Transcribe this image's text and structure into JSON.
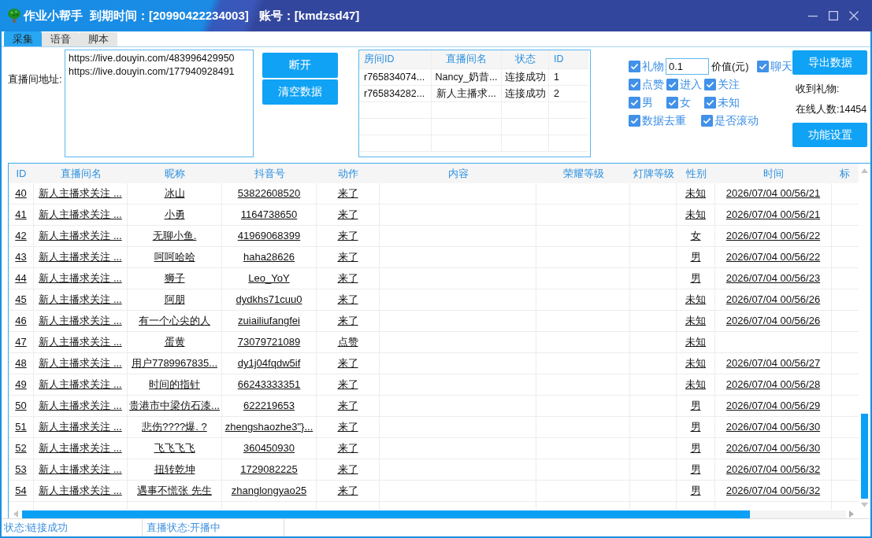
{
  "window": {
    "app_name": "作业小帮手",
    "expiry": "到期时间：[20990422234003]",
    "account": "账号：[kmdzsd47]"
  },
  "tabs": [
    {
      "label": "采集",
      "selected": true
    },
    {
      "label": "语音",
      "selected": false
    },
    {
      "label": "脚本",
      "selected": false
    }
  ],
  "address": {
    "label": "直播间地址:",
    "lines": [
      "https://live.douyin.com/483996429950",
      "https://live.douyin.com/177940928491"
    ]
  },
  "actions": [
    "断开",
    "清空数据"
  ],
  "rooms": {
    "columns": [
      "房间ID",
      "直播间名",
      "状态",
      "ID"
    ],
    "rows": [
      [
        "r765834074...",
        "Nancy_奶昔...",
        "连接成功",
        "1"
      ],
      [
        "r765834282...",
        "新人主播求...",
        "连接成功",
        "2"
      ]
    ]
  },
  "filters": [
    {
      "items": [
        {
          "kind": "checkbox",
          "label": "礼物",
          "checked": true
        },
        {
          "kind": "input",
          "value": "0.1"
        },
        {
          "kind": "text",
          "label": "价值(元)"
        },
        {
          "kind": "checkbox",
          "label": "聊天",
          "checked": true
        }
      ]
    },
    {
      "items": [
        {
          "kind": "checkbox",
          "label": "点赞",
          "checked": true
        },
        {
          "kind": "checkbox",
          "label": "进入",
          "checked": true
        },
        {
          "kind": "checkbox",
          "label": "关注",
          "checked": true
        }
      ]
    },
    {
      "items": [
        {
          "kind": "checkbox",
          "label": "男",
          "checked": true
        },
        {
          "kind": "checkbox",
          "label": "女",
          "checked": true
        },
        {
          "kind": "checkbox",
          "label": "未知",
          "checked": true
        }
      ]
    },
    {
      "items": [
        {
          "kind": "checkbox",
          "label": "数据去重",
          "checked": true
        },
        {
          "kind": "checkbox",
          "label": "是否滚动",
          "checked": true
        }
      ]
    }
  ],
  "side": {
    "export_button": "导出数据",
    "gifts_label": "收到礼物:",
    "online": "在线人数:14454",
    "settings_button": "功能设置"
  },
  "table": {
    "columns": [
      "ID",
      "直播间名",
      "昵称",
      "抖音号",
      "动作",
      "内容",
      "荣耀等级",
      "灯牌等级",
      "性别",
      "时间",
      "标"
    ],
    "rows": [
      {
        "id": "40",
        "live_room": "新人主播求关注 ...",
        "nickname": "冰山",
        "douyin_id": "53822608520",
        "action": "来了",
        "gender": "未知",
        "time": "2026/07/04 00/56/21"
      },
      {
        "id": "41",
        "live_room": "新人主播求关注 ...",
        "nickname": "小勇",
        "douyin_id": "1164738650",
        "action": "来了",
        "gender": "未知",
        "time": "2026/07/04 00/56/21"
      },
      {
        "id": "42",
        "live_room": "新人主播求关注 ...",
        "nickname": "无聊小鱼.",
        "douyin_id": "41969068399",
        "action": "来了",
        "gender": "女",
        "time": "2026/07/04 00/56/22"
      },
      {
        "id": "43",
        "live_room": "新人主播求关注 ...",
        "nickname": "呵呵哈哈",
        "douyin_id": "haha28626",
        "action": "来了",
        "gender": "男",
        "time": "2026/07/04 00/56/22"
      },
      {
        "id": "44",
        "live_room": "新人主播求关注 ...",
        "nickname": "狮子",
        "douyin_id": "Leo_YoY",
        "action": "来了",
        "gender": "男",
        "time": "2026/07/04 00/56/23"
      },
      {
        "id": "45",
        "live_room": "新人主播求关注 ...",
        "nickname": "阿朋",
        "douyin_id": "dydkhs71cuu0",
        "action": "来了",
        "gender": "未知",
        "time": "2026/07/04 00/56/26"
      },
      {
        "id": "46",
        "live_room": "新人主播求关注 ...",
        "nickname": "有一个心尖的人",
        "douyin_id": "zuiailiufangfei",
        "action": "来了",
        "gender": "未知",
        "time": "2026/07/04 00/56/26"
      },
      {
        "id": "47",
        "live_room": "新人主播求关注 ...",
        "nickname": "蛋黄",
        "douyin_id": "73079721089",
        "action": "点赞",
        "gender": "未知"
      },
      {
        "id": "48",
        "live_room": "新人主播求关注 ...",
        "nickname": "用户7789967835...",
        "douyin_id": "dy1j04fqdw5if",
        "action": "来了",
        "gender": "未知",
        "time": "2026/07/04 00/56/27"
      },
      {
        "id": "49",
        "live_room": "新人主播求关注 ...",
        "nickname": "时间的指针",
        "douyin_id": "66243333351",
        "action": "来了",
        "gender": "未知",
        "time": "2026/07/04 00/56/28"
      },
      {
        "id": "50",
        "live_room": "新人主播求关注 ...",
        "nickname": "贵港市中梁仿石漆...",
        "douyin_id": "622219653",
        "action": "来了",
        "gender": "男",
        "time": "2026/07/04 00/56/29"
      },
      {
        "id": "51",
        "live_room": "新人主播求关注 ...",
        "nickname": "悲伤????爆. ?",
        "douyin_id": "zhengshaozhe3\"}...",
        "action": "来了",
        "gender": "男",
        "time": "2026/07/04 00/56/30"
      },
      {
        "id": "52",
        "live_room": "新人主播求关注 ...",
        "nickname": "飞飞飞飞",
        "douyin_id": "360450930",
        "action": "来了",
        "gender": "男",
        "time": "2026/07/04 00/56/30"
      },
      {
        "id": "53",
        "live_room": "新人主播求关注 ...",
        "nickname": "扭转乾坤",
        "douyin_id": "1729082225",
        "action": "来了",
        "gender": "男",
        "time": "2026/07/04 00/56/32"
      },
      {
        "id": "54",
        "live_room": "新人主播求关注 ...",
        "nickname": "遇事不慌张 先生",
        "douyin_id": "zhanglongyao25",
        "action": "来了",
        "gender": "男",
        "time": "2026/07/04 00/56/32"
      }
    ]
  },
  "status_bar": [
    "状态:链接成功",
    "直播状态:开播中"
  ]
}
